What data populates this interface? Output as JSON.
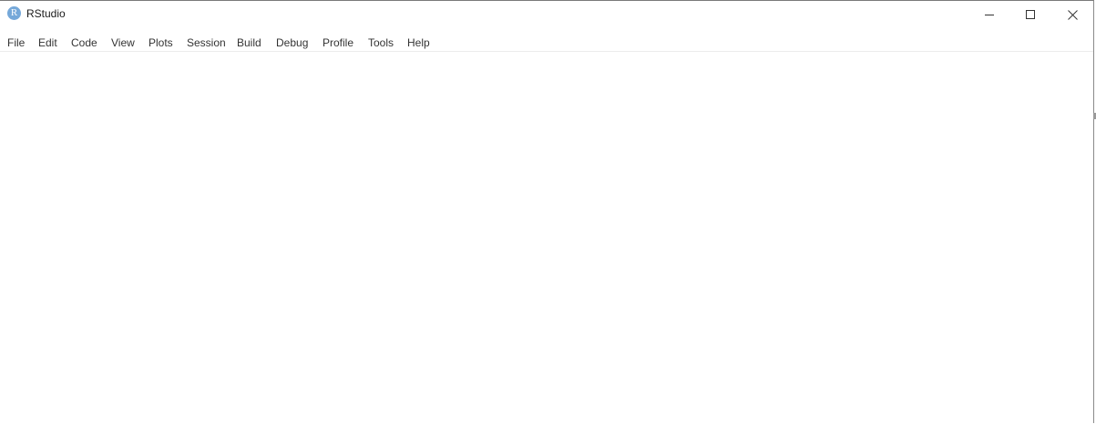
{
  "window": {
    "title": "RStudio",
    "icon": "rstudio-logo-icon",
    "icon_letter": "R",
    "icon_color": "#75a8d9"
  },
  "window_controls": {
    "minimize": "minimize-icon",
    "maximize": "maximize-icon",
    "close": "close-icon"
  },
  "menu": {
    "items": [
      {
        "label": "File"
      },
      {
        "label": "Edit"
      },
      {
        "label": "Code"
      },
      {
        "label": "View"
      },
      {
        "label": "Plots"
      },
      {
        "label": "Session"
      },
      {
        "label": "Build"
      },
      {
        "label": "Debug"
      },
      {
        "label": "Profile"
      },
      {
        "label": "Tools"
      },
      {
        "label": "Help"
      }
    ]
  }
}
